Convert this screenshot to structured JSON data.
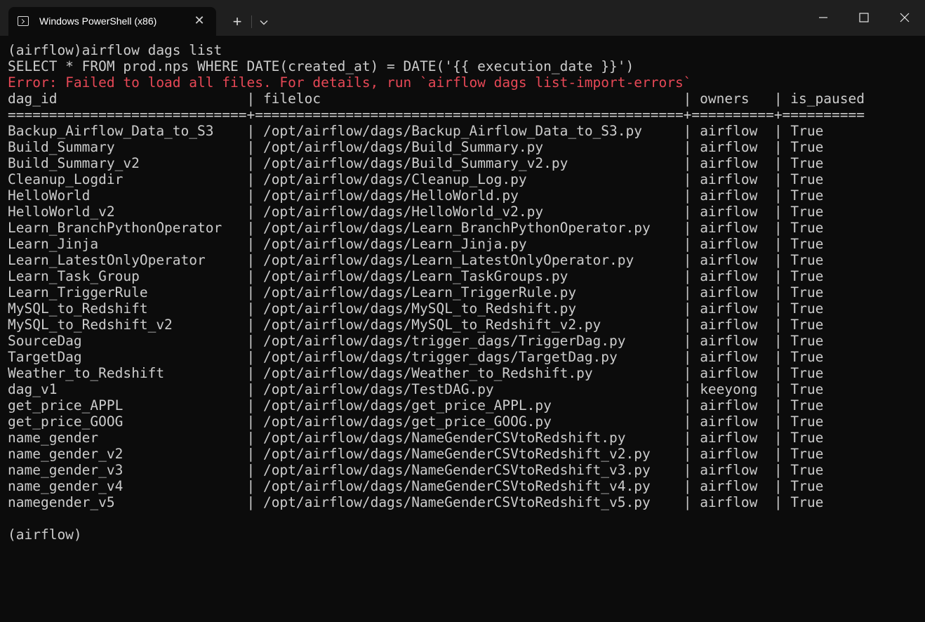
{
  "window": {
    "tab_title": "Windows PowerShell (x86)",
    "tab_close_glyph": "✕",
    "new_tab_glyph": "+"
  },
  "terminal": {
    "command_line": "(airflow)airflow dags list",
    "sql_line": "SELECT * FROM prod.nps WHERE DATE(created_at) = DATE('{{ execution_date }}')",
    "error_line": "Error: Failed to load all files. For details, run `airflow dags list-import-errors`",
    "table_header": "dag_id                       | fileloc                                            | owners   | is_paused",
    "table_separator": "=============================+====================================================+==========+==========",
    "rows": [
      {
        "dag_id": "Backup_Airflow_Data_to_S3",
        "fileloc": "/opt/airflow/dags/Backup_Airflow_Data_to_S3.py",
        "owners": "airflow",
        "is_paused": "True"
      },
      {
        "dag_id": "Build_Summary",
        "fileloc": "/opt/airflow/dags/Build_Summary.py",
        "owners": "airflow",
        "is_paused": "True"
      },
      {
        "dag_id": "Build_Summary_v2",
        "fileloc": "/opt/airflow/dags/Build_Summary_v2.py",
        "owners": "airflow",
        "is_paused": "True"
      },
      {
        "dag_id": "Cleanup_Logdir",
        "fileloc": "/opt/airflow/dags/Cleanup_Log.py",
        "owners": "airflow",
        "is_paused": "True"
      },
      {
        "dag_id": "HelloWorld",
        "fileloc": "/opt/airflow/dags/HelloWorld.py",
        "owners": "airflow",
        "is_paused": "True"
      },
      {
        "dag_id": "HelloWorld_v2",
        "fileloc": "/opt/airflow/dags/HelloWorld_v2.py",
        "owners": "airflow",
        "is_paused": "True"
      },
      {
        "dag_id": "Learn_BranchPythonOperator",
        "fileloc": "/opt/airflow/dags/Learn_BranchPythonOperator.py",
        "owners": "airflow",
        "is_paused": "True"
      },
      {
        "dag_id": "Learn_Jinja",
        "fileloc": "/opt/airflow/dags/Learn_Jinja.py",
        "owners": "airflow",
        "is_paused": "True"
      },
      {
        "dag_id": "Learn_LatestOnlyOperator",
        "fileloc": "/opt/airflow/dags/Learn_LatestOnlyOperator.py",
        "owners": "airflow",
        "is_paused": "True"
      },
      {
        "dag_id": "Learn_Task_Group",
        "fileloc": "/opt/airflow/dags/Learn_TaskGroups.py",
        "owners": "airflow",
        "is_paused": "True"
      },
      {
        "dag_id": "Learn_TriggerRule",
        "fileloc": "/opt/airflow/dags/Learn_TriggerRule.py",
        "owners": "airflow",
        "is_paused": "True"
      },
      {
        "dag_id": "MySQL_to_Redshift",
        "fileloc": "/opt/airflow/dags/MySQL_to_Redshift.py",
        "owners": "airflow",
        "is_paused": "True"
      },
      {
        "dag_id": "MySQL_to_Redshift_v2",
        "fileloc": "/opt/airflow/dags/MySQL_to_Redshift_v2.py",
        "owners": "airflow",
        "is_paused": "True"
      },
      {
        "dag_id": "SourceDag",
        "fileloc": "/opt/airflow/dags/trigger_dags/TriggerDag.py",
        "owners": "airflow",
        "is_paused": "True"
      },
      {
        "dag_id": "TargetDag",
        "fileloc": "/opt/airflow/dags/trigger_dags/TargetDag.py",
        "owners": "airflow",
        "is_paused": "True"
      },
      {
        "dag_id": "Weather_to_Redshift",
        "fileloc": "/opt/airflow/dags/Weather_to_Redshift.py",
        "owners": "airflow",
        "is_paused": "True"
      },
      {
        "dag_id": "dag_v1",
        "fileloc": "/opt/airflow/dags/TestDAG.py",
        "owners": "keeyong",
        "is_paused": "True"
      },
      {
        "dag_id": "get_price_APPL",
        "fileloc": "/opt/airflow/dags/get_price_APPL.py",
        "owners": "airflow",
        "is_paused": "True"
      },
      {
        "dag_id": "get_price_GOOG",
        "fileloc": "/opt/airflow/dags/get_price_GOOG.py",
        "owners": "airflow",
        "is_paused": "True"
      },
      {
        "dag_id": "name_gender",
        "fileloc": "/opt/airflow/dags/NameGenderCSVtoRedshift.py",
        "owners": "airflow",
        "is_paused": "True"
      },
      {
        "dag_id": "name_gender_v2",
        "fileloc": "/opt/airflow/dags/NameGenderCSVtoRedshift_v2.py",
        "owners": "airflow",
        "is_paused": "True"
      },
      {
        "dag_id": "name_gender_v3",
        "fileloc": "/opt/airflow/dags/NameGenderCSVtoRedshift_v3.py",
        "owners": "airflow",
        "is_paused": "True"
      },
      {
        "dag_id": "name_gender_v4",
        "fileloc": "/opt/airflow/dags/NameGenderCSVtoRedshift_v4.py",
        "owners": "airflow",
        "is_paused": "True"
      },
      {
        "dag_id": "namegender_v5",
        "fileloc": "/opt/airflow/dags/NameGenderCSVtoRedshift_v5.py",
        "owners": "airflow",
        "is_paused": "True"
      }
    ],
    "prompt": "(airflow)"
  },
  "colors": {
    "background": "#0c0c0c",
    "titlebar": "#1f1f1f",
    "text": "#cccccc",
    "error": "#e74856"
  }
}
